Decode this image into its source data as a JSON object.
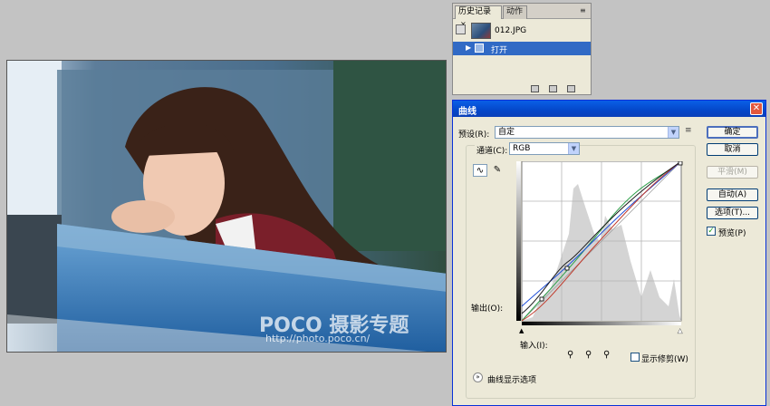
{
  "photo": {
    "watermark_logo": "POCO 摄影专题",
    "watermark_url": "http://photo.poco.cn/"
  },
  "history_panel": {
    "tabs": [
      {
        "label": "历史记录",
        "close": "×",
        "active": true
      },
      {
        "label": "动作",
        "active": false
      }
    ],
    "snapshot_name": "012.JPG",
    "states": [
      {
        "label": "打开",
        "selected": true
      }
    ],
    "menu_icon": "≡"
  },
  "curves_dialog": {
    "title": "曲线",
    "close_label": "✕",
    "preset_label": "预设(R):",
    "preset_value": "自定",
    "preset_menu_icon": "≡",
    "channel_label": "通道(C):",
    "channel_value": "RGB",
    "output_label": "输出(O):",
    "input_label": "输入(I):",
    "show_clipping_label": "显示修剪(W)",
    "curve_display_options": "曲线显示选项",
    "buttons": {
      "ok": "确定",
      "cancel": "取消",
      "smooth": "平滑(M)",
      "auto": "自动(A)",
      "options": "选项(T)..."
    },
    "preview_label": "预览(P)",
    "preview_checked": true,
    "colors": {
      "rgb": "#1a1a1a",
      "red": "#c0392b",
      "green": "#2ea04a",
      "blue": "#1f4fd8",
      "histogram": "#c9c9c9"
    }
  }
}
